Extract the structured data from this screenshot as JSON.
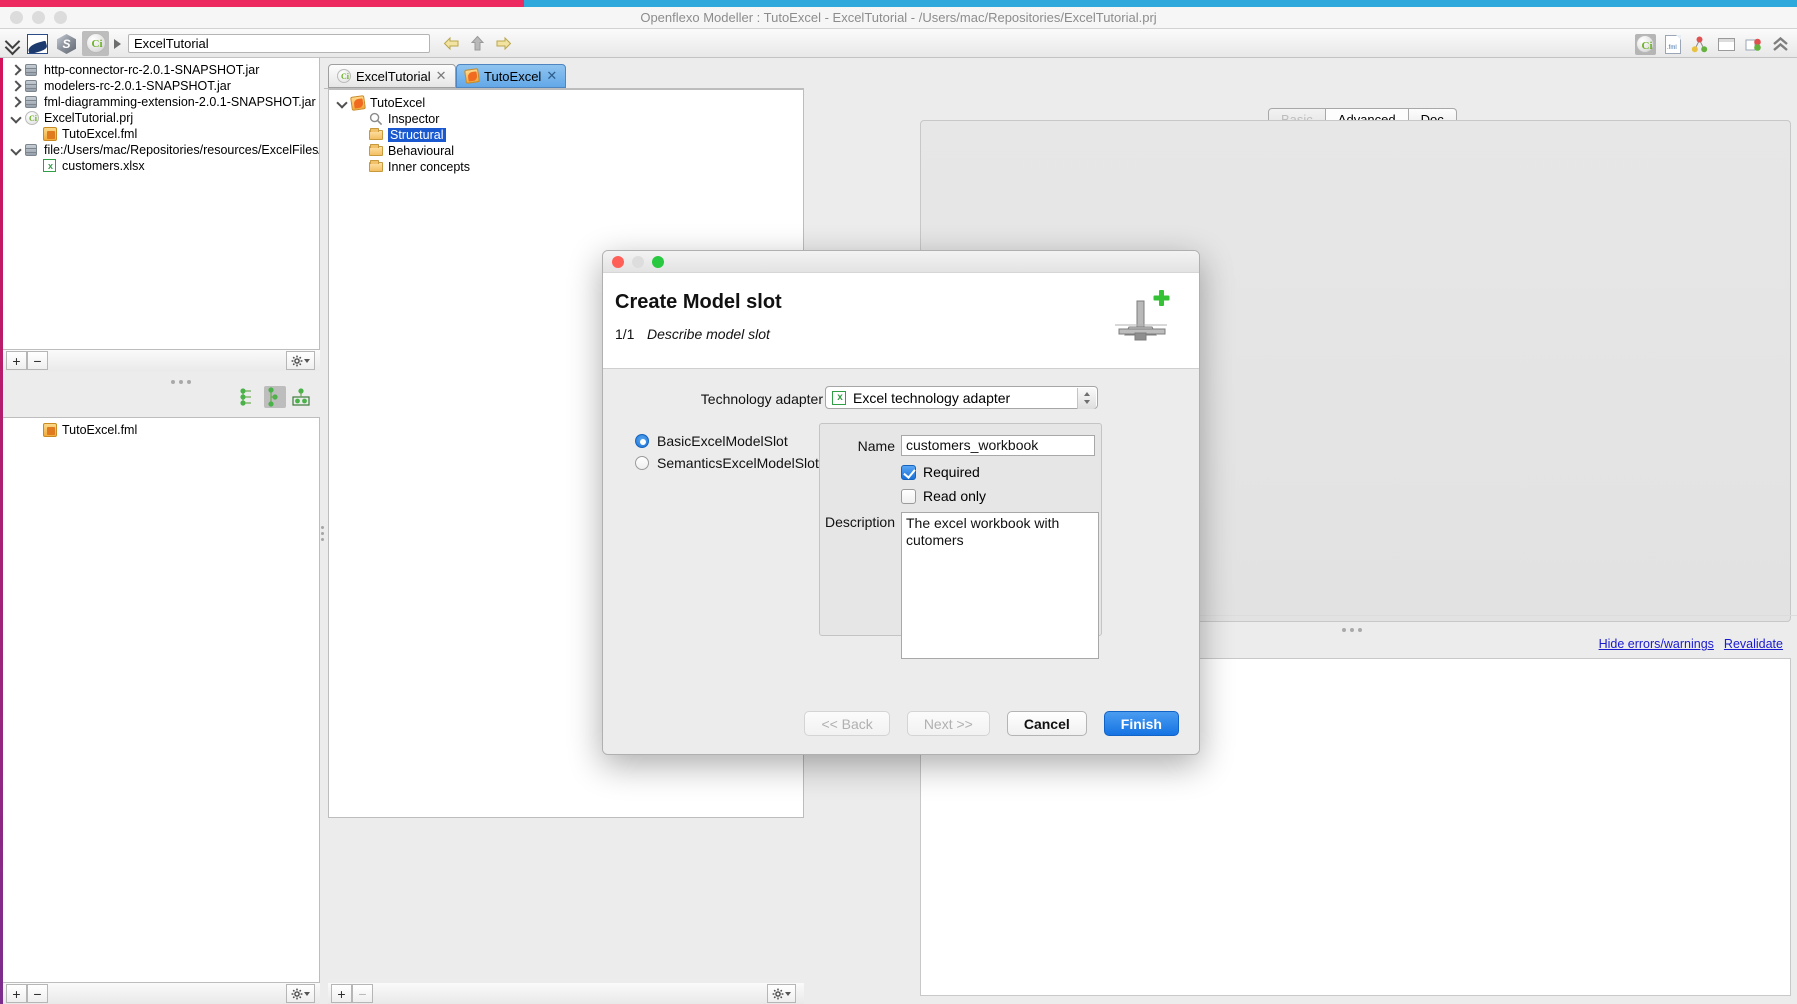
{
  "window": {
    "title": "Openflexo Modeller : TutoExcel - ExcelTutorial - /Users/mac/Repositories/ExcelTutorial.prj",
    "stripe_pink": "#ec2a5f",
    "stripe_blue": "#2fa8dc"
  },
  "toolbar": {
    "path_value": "ExcelTutorial",
    "icons": [
      "chevrons-down-icon",
      "openflexo-icon",
      "cube-icon",
      "ci-project-icon"
    ],
    "nav": [
      "back-arrow-icon",
      "up-arrow-icon",
      "forward-arrow-icon"
    ],
    "right_icons": [
      "ci-perspective-icon",
      "fml-perspective-icon",
      "diagram-perspective-icon",
      "window-perspective-icon",
      "doc-perspective-icon",
      "collapse-icon"
    ]
  },
  "left_panel": {
    "tree": [
      {
        "label": "http-connector-rc-2.0.1-SNAPSHOT.jar",
        "icon": "database-icon",
        "twisty": "closed",
        "indent": 0
      },
      {
        "label": "modelers-rc-2.0.1-SNAPSHOT.jar",
        "icon": "database-icon",
        "twisty": "closed",
        "indent": 0
      },
      {
        "label": "fml-diagramming-extension-2.0.1-SNAPSHOT.jar",
        "icon": "database-icon",
        "twisty": "closed",
        "indent": 0
      },
      {
        "label": "ExcelTutorial.prj",
        "icon": "project-icon",
        "twisty": "open",
        "indent": 0
      },
      {
        "label": "TutoExcel.fml",
        "icon": "fml-icon",
        "twisty": "none",
        "indent": 1
      },
      {
        "label": "file:/Users/mac/Repositories/resources/ExcelFiles/",
        "icon": "database-icon",
        "twisty": "open",
        "indent": 0
      },
      {
        "label": "customers.xlsx",
        "icon": "excel-icon",
        "twisty": "none",
        "indent": 1
      }
    ],
    "toolbar": {
      "add": "+",
      "remove": "−",
      "settings": "gear-icon"
    },
    "bottom_tree": [
      {
        "label": "TutoExcel.fml",
        "icon": "fml-icon",
        "twisty": "none",
        "indent": 1
      }
    ],
    "bottom_toolbar": {
      "add": "+",
      "remove": "−",
      "settings": "gear-icon"
    },
    "view_buttons": [
      "list-view-icon",
      "tree-view-icon",
      "group-view-icon"
    ]
  },
  "center_panel": {
    "tabs": [
      {
        "label": "ExcelTutorial",
        "icon": "project-icon",
        "active": false,
        "close": "✕"
      },
      {
        "label": "TutoExcel",
        "icon": "viewpoint-icon",
        "active": true,
        "close": "✕"
      }
    ],
    "tree": [
      {
        "label": "TutoExcel",
        "icon": "viewpoint-icon",
        "twisty": "open",
        "indent": 0,
        "selected": false
      },
      {
        "label": "Inspector",
        "icon": "magnifier-icon",
        "twisty": "none",
        "indent": 1,
        "selected": false
      },
      {
        "label": "Structural",
        "icon": "folder-icon",
        "twisty": "none",
        "indent": 1,
        "selected": true
      },
      {
        "label": "Behavioural",
        "icon": "folder-icon",
        "twisty": "none",
        "indent": 1,
        "selected": false
      },
      {
        "label": "Inner concepts",
        "icon": "folder-icon",
        "twisty": "none",
        "indent": 1,
        "selected": false
      }
    ],
    "bottom_toolbar": {
      "add": "+",
      "remove": "−",
      "settings": "gear-icon"
    }
  },
  "right_panel": {
    "tabs": [
      {
        "label": "Basic",
        "state": "disabled"
      },
      {
        "label": "Advanced",
        "state": "active"
      },
      {
        "label": "Doc",
        "state": "normal"
      }
    ],
    "links": [
      {
        "label": "Hide errors/warnings"
      },
      {
        "label": "Revalidate"
      }
    ]
  },
  "dialog": {
    "title": "Create Model slot",
    "step": "1/1",
    "substep": "Describe model slot",
    "header_icon": "model-slot-add-icon",
    "technology_label": "Technology adapter",
    "technology_value": "Excel technology adapter",
    "technology_icon": "excel-icon",
    "radios": [
      {
        "label": "BasicExcelModelSlot",
        "checked": true
      },
      {
        "label": "SemanticsExcelModelSlot",
        "checked": false
      }
    ],
    "fields": {
      "name_label": "Name",
      "name_value": "customers_workbook",
      "required_label": "Required",
      "required_checked": true,
      "readonly_label": "Read only",
      "readonly_checked": false,
      "description_label": "Description",
      "description_value": "The excel workbook with cutomers"
    },
    "buttons": [
      {
        "label": "<< Back",
        "state": "disabled"
      },
      {
        "label": "Next >>",
        "state": "disabled"
      },
      {
        "label": "Cancel",
        "state": "normal"
      },
      {
        "label": "Finish",
        "state": "primary"
      }
    ]
  }
}
